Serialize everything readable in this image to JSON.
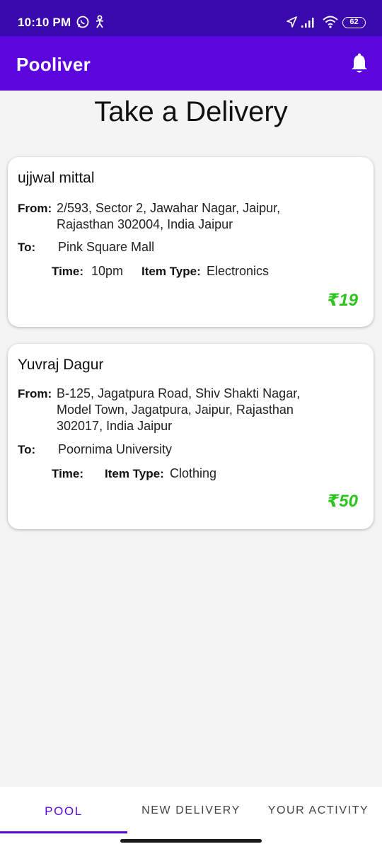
{
  "status_bar": {
    "time": "10:10 PM",
    "battery": "62"
  },
  "app_bar": {
    "title": "Pooliver",
    "icons": [
      "bell-icon"
    ]
  },
  "page": {
    "title": "Take a Delivery"
  },
  "deliveries": [
    {
      "name": "ujjwal mittal",
      "from_label": "From:",
      "from_lines": [
        "2/593, Sector 2, Jawahar Nagar, Jaipur,",
        "Rajasthan 302004, India Jaipur"
      ],
      "to_label": "To:",
      "to": "Pink Square Mall",
      "time_label": "Time:",
      "time": "10pm",
      "item_type_label": "Item Type:",
      "item_type": "Electronics",
      "price": "₹19"
    },
    {
      "name": "Yuvraj Dagur",
      "from_label": "From:",
      "from_lines": [
        "B-125, Jagatpura Road, Shiv Shakti Nagar,",
        "Model Town, Jagatpura, Jaipur, Rajasthan",
        "302017, India Jaipur"
      ],
      "to_label": "To:",
      "to": "Poornima University",
      "time_label": "Time:",
      "time": "",
      "item_type_label": "Item Type:",
      "item_type": "Clothing",
      "price": "₹50"
    }
  ],
  "bottom_nav": {
    "tabs": [
      {
        "label": "POOL",
        "active": true
      },
      {
        "label": "NEW DELIVERY",
        "active": false
      },
      {
        "label": "YOUR ACTIVITY",
        "active": false
      }
    ]
  },
  "colors": {
    "status_bar": "#3a09ad",
    "app_bar": "#5b06dd",
    "accent": "#5b06dd",
    "price": "#2bc41b",
    "background": "#f4f4f4"
  }
}
